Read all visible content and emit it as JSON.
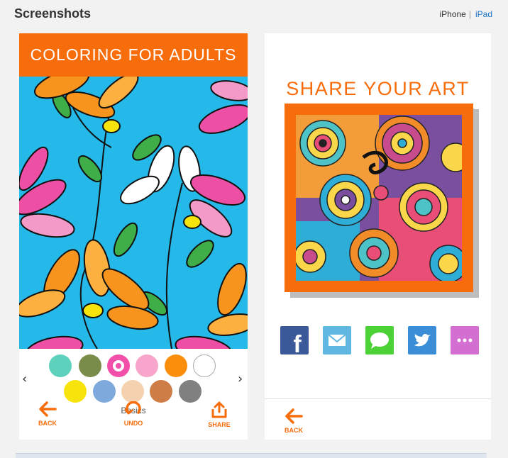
{
  "header": {
    "title": "Screenshots",
    "device_iphone": "iPhone",
    "separator": "|",
    "device_ipad": "iPad"
  },
  "screenshot1": {
    "banner": "COLORING FOR ADULTS",
    "palette": {
      "prev_icon": "chevron-left-icon",
      "next_icon": "chevron-right-icon",
      "row1": [
        "#5ed1bd",
        "#7a8c4a",
        "#f14fa9",
        "#f7a5cb",
        "#fb8f0c",
        "#ffffff"
      ],
      "row2": [
        "#f6e40c",
        "#7da9dc",
        "#f5d2af",
        "#cf7d47",
        "#808080"
      ],
      "selected_index": 2,
      "label": "Basics"
    },
    "toolbar": {
      "back": "BACK",
      "undo": "UNDO",
      "share": "SHARE"
    }
  },
  "screenshot2": {
    "title": "SHARE YOUR ART",
    "social": [
      {
        "icon": "facebook-icon",
        "color": "#3b5998"
      },
      {
        "icon": "email-icon",
        "color": "#5fb7e2"
      },
      {
        "icon": "message-icon",
        "color": "#4cd137"
      },
      {
        "icon": "twitter-icon",
        "color": "#3a8dd6"
      },
      {
        "icon": "more-icon",
        "color": "#d36fd0"
      }
    ],
    "back": "BACK"
  },
  "colors": {
    "accent": "#f76d0c",
    "link": "#1a73c4"
  }
}
